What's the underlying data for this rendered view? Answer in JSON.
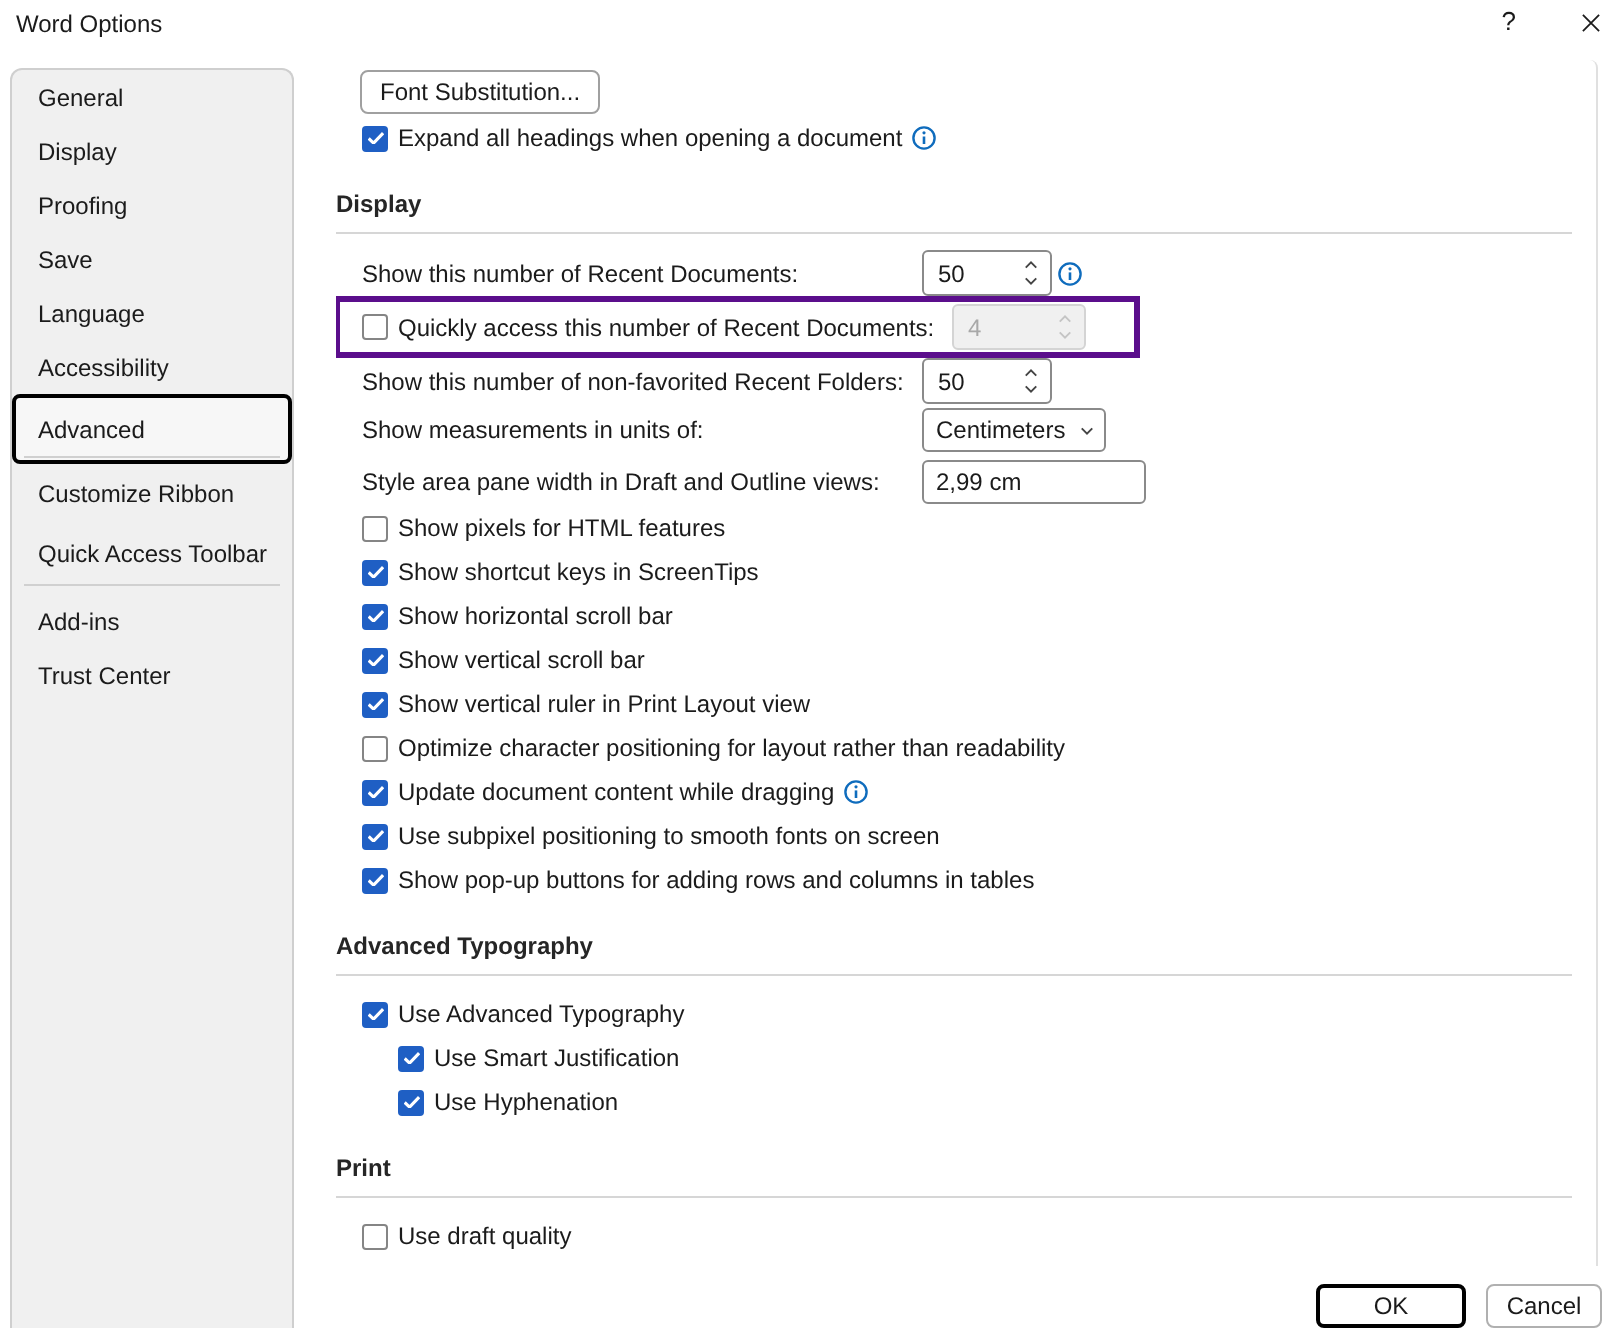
{
  "window": {
    "title": "Word Options",
    "help": "?"
  },
  "sidebar": {
    "groups": [
      {
        "items": [
          {
            "label": "General",
            "selected": false
          },
          {
            "label": "Display",
            "selected": false
          },
          {
            "label": "Proofing",
            "selected": false
          },
          {
            "label": "Save",
            "selected": false
          },
          {
            "label": "Language",
            "selected": false
          },
          {
            "label": "Accessibility",
            "selected": false
          },
          {
            "label": "Advanced",
            "selected": true
          }
        ]
      },
      {
        "items": [
          {
            "label": "Customize Ribbon",
            "selected": false
          },
          {
            "label": "Quick Access Toolbar",
            "selected": false
          }
        ]
      },
      {
        "items": [
          {
            "label": "Add-ins",
            "selected": false
          },
          {
            "label": "Trust Center",
            "selected": false
          }
        ]
      }
    ]
  },
  "content": {
    "sections": [
      {
        "rows": [
          {
            "kind": "button",
            "label": "Font Substitution..."
          },
          {
            "kind": "checkbox",
            "label": "Expand all headings when opening a document",
            "checked": true,
            "info": true
          }
        ]
      },
      {
        "heading": "Display",
        "rows": [
          {
            "kind": "spinner",
            "label": "Show this number of Recent Documents:",
            "value": "50",
            "disabled": false,
            "info": true
          },
          {
            "kind": "checkbox_spinner",
            "label": "Quickly access this number of Recent Documents:",
            "checked": false,
            "value": "4",
            "disabled": true,
            "highlighted": true
          },
          {
            "kind": "spinner",
            "label": "Show this number of non-favorited Recent Folders:",
            "value": "50",
            "disabled": false
          },
          {
            "kind": "dropdown",
            "label": "Show measurements in units of:",
            "value": "Centimeters"
          },
          {
            "kind": "text",
            "label": "Style area pane width in Draft and Outline views:",
            "value": "2,99 cm"
          },
          {
            "kind": "checkbox",
            "label": "Show pixels for HTML features",
            "checked": false
          },
          {
            "kind": "checkbox",
            "label": "Show shortcut keys in ScreenTips",
            "checked": true
          },
          {
            "kind": "checkbox",
            "label": "Show horizontal scroll bar",
            "checked": true
          },
          {
            "kind": "checkbox",
            "label": "Show vertical scroll bar",
            "checked": true
          },
          {
            "kind": "checkbox",
            "label": "Show vertical ruler in Print Layout view",
            "checked": true
          },
          {
            "kind": "checkbox",
            "label": "Optimize character positioning for layout rather than readability",
            "checked": false
          },
          {
            "kind": "checkbox",
            "label": "Update document content while dragging",
            "checked": true,
            "info": true
          },
          {
            "kind": "checkbox",
            "label": "Use subpixel positioning to smooth fonts on screen",
            "checked": true
          },
          {
            "kind": "checkbox",
            "label": "Show pop-up buttons for adding rows and columns in tables",
            "checked": true
          }
        ]
      },
      {
        "heading": "Advanced Typography",
        "rows": [
          {
            "kind": "checkbox",
            "label": "Use Advanced Typography",
            "checked": true,
            "children": [
              {
                "kind": "checkbox",
                "label": "Use Smart Justification",
                "checked": true
              },
              {
                "kind": "checkbox",
                "label": "Use Hyphenation",
                "checked": true
              }
            ]
          }
        ]
      },
      {
        "heading": "Print",
        "rows": [
          {
            "kind": "checkbox",
            "label": "Use draft quality",
            "checked": false
          }
        ]
      }
    ]
  },
  "buttons": [
    {
      "label": "OK",
      "default": true
    },
    {
      "label": "Cancel",
      "default": false
    }
  ]
}
